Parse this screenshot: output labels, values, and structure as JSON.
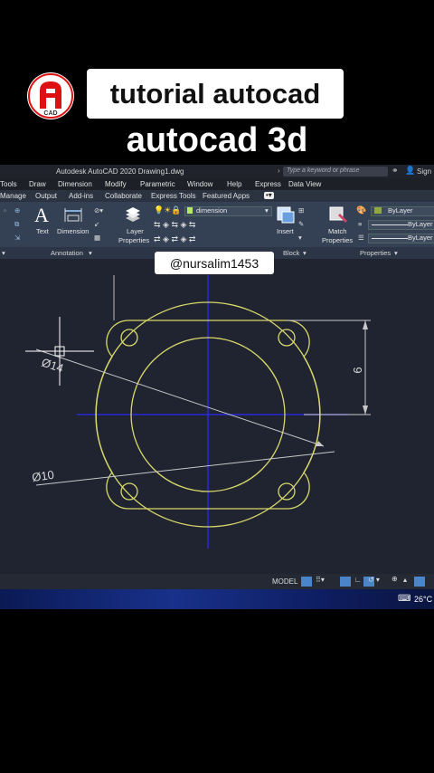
{
  "overlay": {
    "logo_text": "CAD",
    "title": "tutorial autocad",
    "subtitle": "autocad 3d",
    "watermark": "@nursalim1453"
  },
  "window": {
    "app_title": "Autodesk AutoCAD 2020   Drawing1.dwg",
    "search_placeholder": "Type a keyword or phrase",
    "sign_in": "Sign I"
  },
  "menu": [
    "Tools",
    "Draw",
    "Dimension",
    "Modify",
    "Parametric",
    "Window",
    "Help",
    "Express",
    "Data View"
  ],
  "ribbon_tabs": [
    "Manage",
    "Output",
    "Add-ins",
    "Collaborate",
    "Express Tools",
    "Featured Apps"
  ],
  "ribbon": {
    "text_label": "Text",
    "dimension_label": "Dimension",
    "annotation_panel": "Annotation",
    "layer_properties_label": [
      "Layer",
      "Properties"
    ],
    "layer_dropdown": "dimension",
    "insert_label": "Insert",
    "block_panel": "Block",
    "match_properties_label": [
      "Match",
      "Properties"
    ],
    "properties_panel": "Properties",
    "bylayer_color": "ByLayer",
    "bylayer_linetype": "ByLayer",
    "bylayer_lineweight": "ByLayer"
  },
  "drawing": {
    "dim_phi14": "Ø14",
    "dim_phi10": "Ø10",
    "dim_vertical": "6"
  },
  "statusbar": {
    "model": "MODEL"
  },
  "taskbar": {
    "temperature": "26°C"
  },
  "colors": {
    "drawing_yellow": "#d8d86a",
    "center_blue": "#2a2ad8",
    "dimension_gray": "#c8c8c8",
    "canvas_bg": "#202431"
  }
}
